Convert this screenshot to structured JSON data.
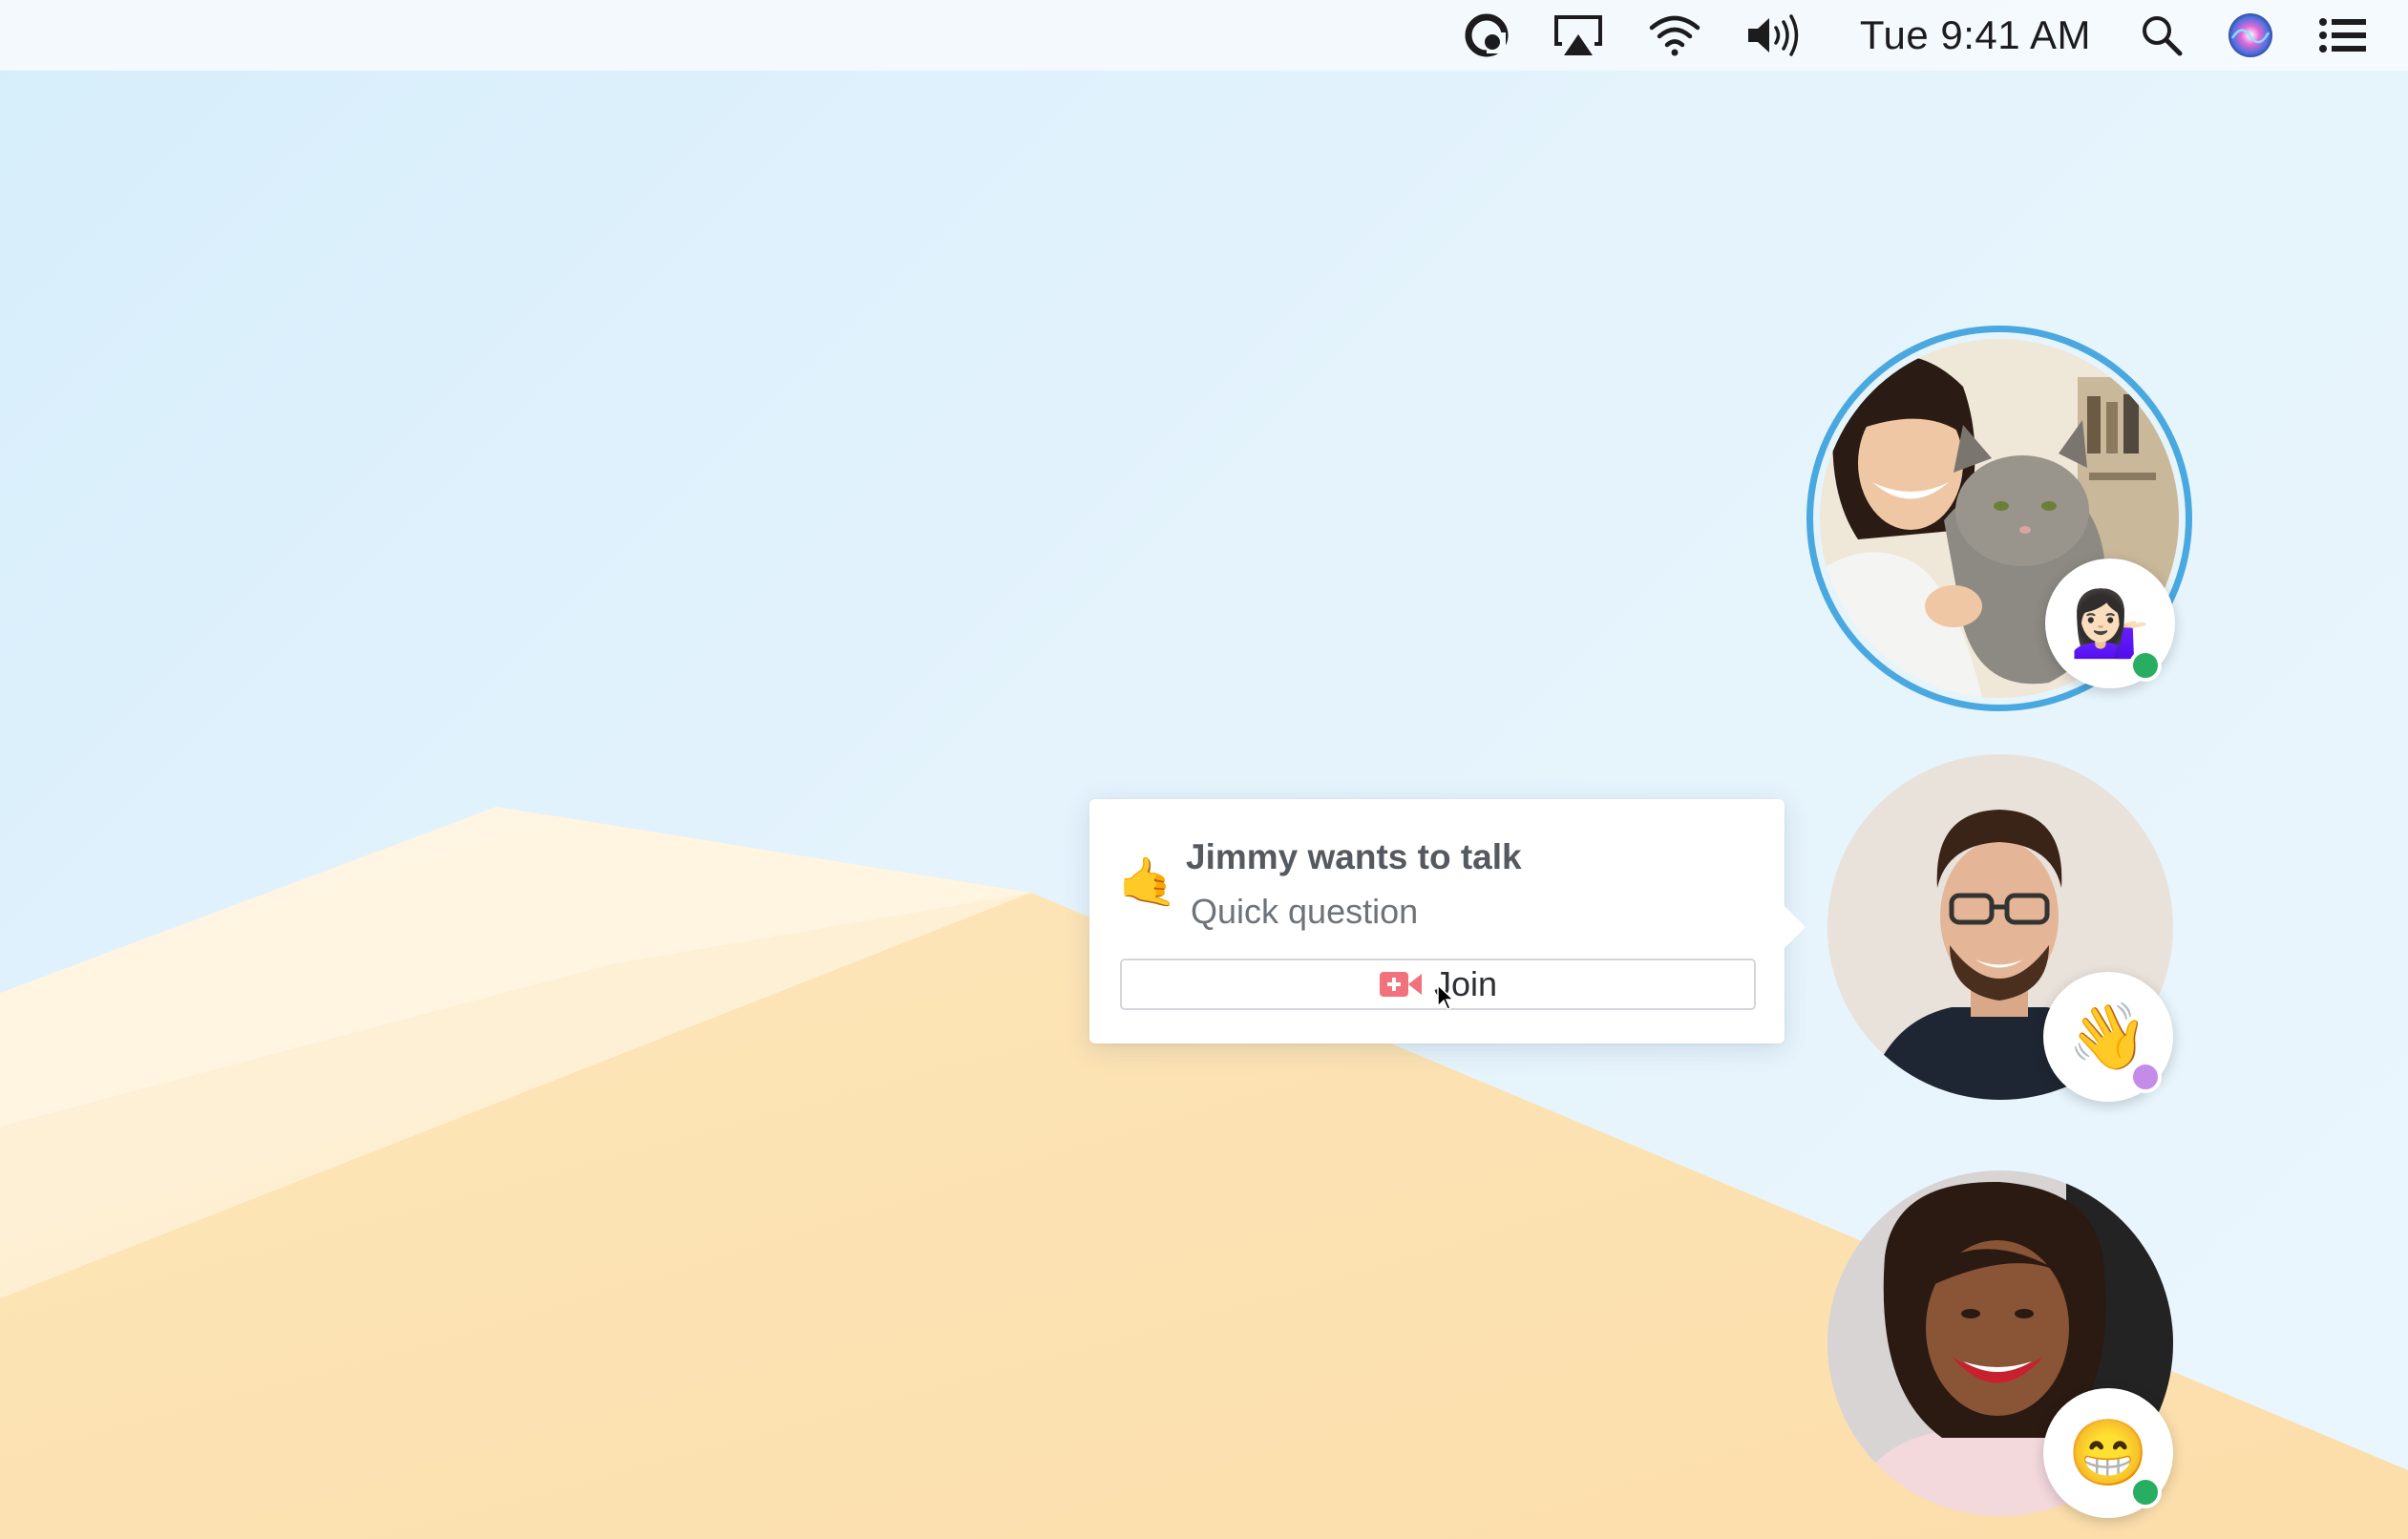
{
  "menubar": {
    "clock": "Tue 9:41 AM",
    "icons": [
      "app-status-icon",
      "airplay-icon",
      "wifi-icon",
      "volume-icon",
      "spotlight-search-icon",
      "siri-icon",
      "notification-center-icon"
    ]
  },
  "people": [
    {
      "emoji": "💁🏻‍♀️",
      "status": "online",
      "status_color": "#27ae60",
      "speaking": true
    },
    {
      "emoji": "👋",
      "status": "away",
      "status_color": "#c58be8",
      "speaking": false
    },
    {
      "emoji": "😁",
      "status": "online",
      "status_color": "#27ae60",
      "speaking": false
    }
  ],
  "notification": {
    "emoji": "🤙",
    "title": "Jimmy wants to talk",
    "subtitle": "Quick question",
    "join_label": "Join"
  },
  "colors": {
    "speaking_ring": "#4aa8e0",
    "join_icon": "#f1727c"
  }
}
